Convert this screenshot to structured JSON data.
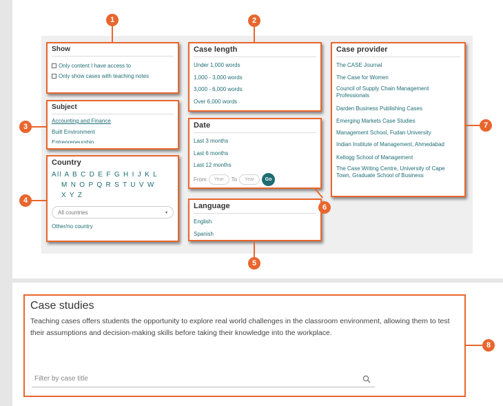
{
  "show": {
    "title": "Show",
    "options": [
      "Only content I have access to",
      "Only show cases with teaching notes"
    ]
  },
  "subject": {
    "title": "Subject",
    "items": [
      "Accounting and Finance",
      "Built Environment",
      "Entrepreneurship"
    ]
  },
  "country": {
    "title": "Country",
    "letters_row1": "All A B C D E F G H I J K L",
    "letters_row2": "M N O P Q R S T U V W",
    "letters_row3": "X Y Z",
    "select_value": "All countries",
    "other": "Other/no country"
  },
  "case_length": {
    "title": "Case length",
    "items": [
      "Under 1,000 words",
      "1,000 - 3,000 words",
      "3,000 - 6,000 words",
      "Over 6,000 words"
    ]
  },
  "date": {
    "title": "Date",
    "items": [
      "Last 3 months",
      "Last 6 months",
      "Last 12 months"
    ],
    "from_label": "From",
    "to_label": "To",
    "year_placeholder": "Year",
    "go_label": "Go"
  },
  "language": {
    "title": "Language",
    "items": [
      "English",
      "Spanish"
    ]
  },
  "case_provider": {
    "title": "Case provider",
    "items": [
      "The CASE Journal",
      "The Case for Women",
      "Council of Supply Chain Management Professionals",
      "Darden Business Publishing Cases",
      "Emerging Markets Case Studies",
      "Management School, Fudan University",
      "Indian Institute of Management, Ahmedabad",
      "Kellogg School of Management",
      "The Case Writing Centre, University of Cape Town, Graduate School of Business"
    ]
  },
  "case_studies": {
    "title": "Case studies",
    "description": "Teaching cases offers students the opportunity to explore real world challenges in the classroom environment, allowing them to test their assumptions and decision-making skills before taking their knowledge into the workplace.",
    "filter_placeholder": "Filter by case title"
  },
  "callouts": [
    "1",
    "2",
    "3",
    "4",
    "5",
    "6",
    "7",
    "8"
  ],
  "colors": {
    "accent": "#e8662d",
    "link": "#1f6d74"
  }
}
